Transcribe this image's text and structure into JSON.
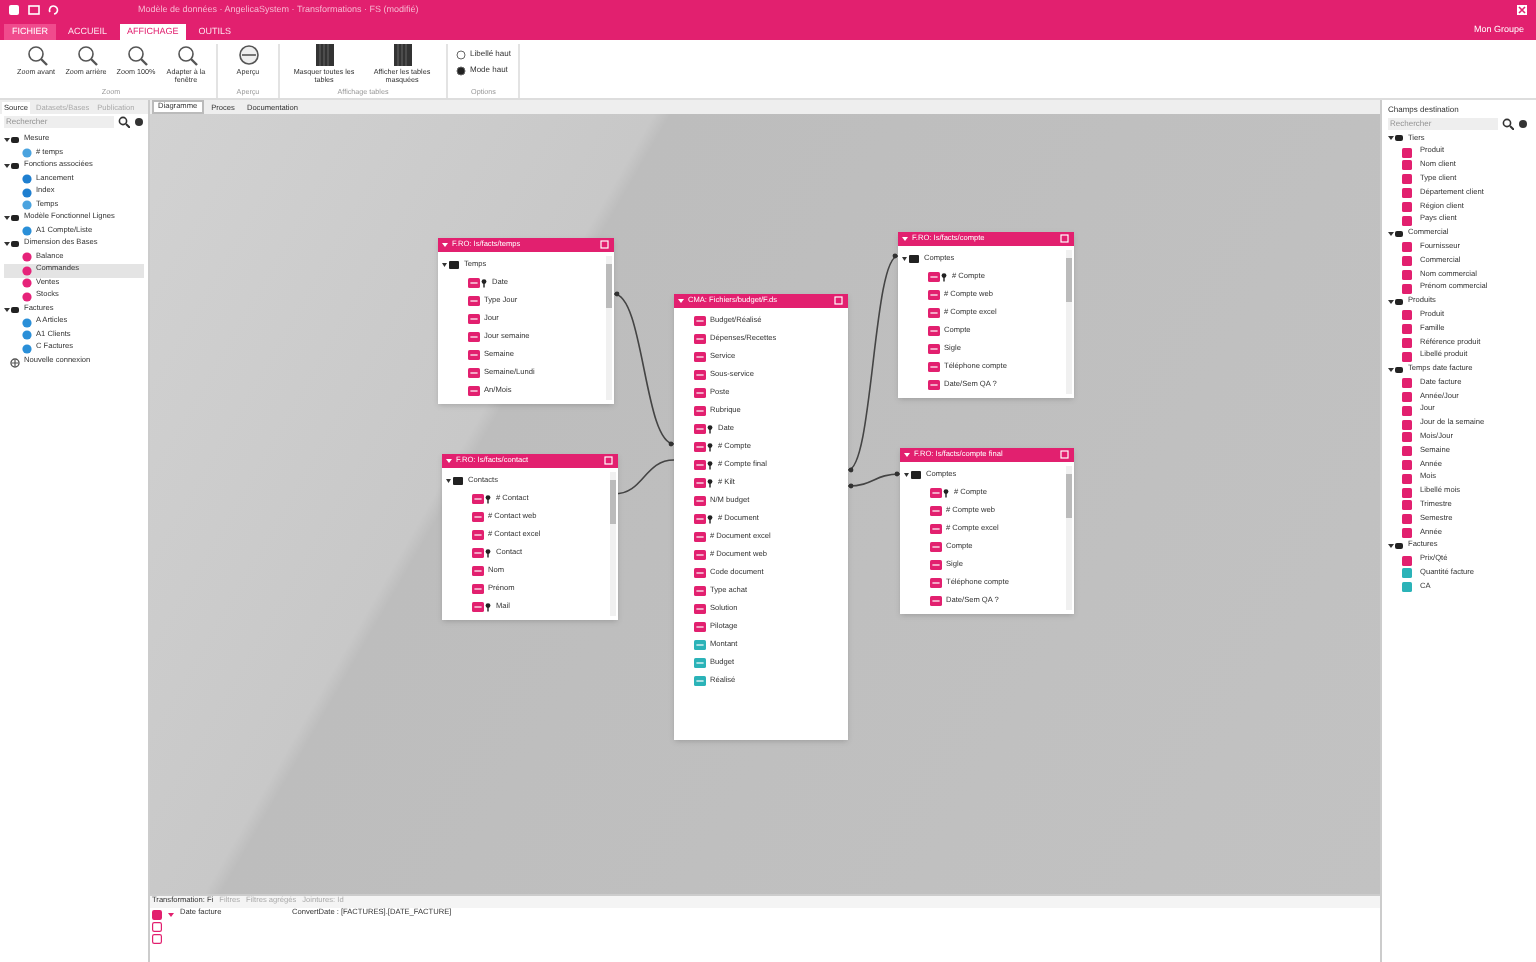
{
  "window": {
    "title": "Modèle de données · AngelicaSystem · Transformations · FS (modifié)",
    "account": "Mon Groupe"
  },
  "ribbon_tabs": [
    {
      "label": "FICHIER",
      "selected": false
    },
    {
      "label": "ACCUEIL",
      "selected": false
    },
    {
      "label": "AFFICHAGE",
      "selected": true
    },
    {
      "label": "OUTILS",
      "selected": false
    }
  ],
  "ribbon_groups": [
    {
      "label": "Zoom",
      "items": [
        {
          "kind": "zoom",
          "label": "Zoom avant"
        },
        {
          "kind": "zoom",
          "label": "Zoom arrière"
        },
        {
          "kind": "zoom",
          "label": "Zoom 100%"
        },
        {
          "kind": "zoom",
          "label": "Adapter à la fenêtre"
        }
      ]
    },
    {
      "label": "Aperçu",
      "items": [
        {
          "kind": "preview",
          "label": "Aperçu"
        }
      ]
    },
    {
      "label": "Affichage tables",
      "items": [
        {
          "kind": "tables",
          "label": "Masquer toutes les tables"
        },
        {
          "kind": "tables",
          "label": "Afficher les tables masquées"
        }
      ]
    },
    {
      "label": "Options",
      "items": [
        {
          "kind": "radio",
          "label": "Libellé haut",
          "selected": false
        },
        {
          "kind": "radio",
          "label": "Mode haut",
          "selected": true
        }
      ]
    }
  ],
  "left_panel": {
    "tabs": [
      {
        "label": "Source",
        "selected": true
      },
      {
        "label": "Datasets/Bases",
        "selected": false
      },
      {
        "label": "Publication",
        "selected": false
      }
    ],
    "search": {
      "placeholder": "Rechercher"
    },
    "tree": [
      {
        "label": "Mesure",
        "children": [
          {
            "label": "# temps",
            "color": "#4aa3df",
            "selected": false
          }
        ]
      },
      {
        "label": "Fonctions associées",
        "children": [
          {
            "label": "Lancement",
            "color": "#1f7fd0",
            "selected": false
          },
          {
            "label": "Index",
            "color": "#1f7fd0",
            "selected": false
          },
          {
            "label": "Temps",
            "color": "#4aa3df",
            "selected": false
          }
        ]
      },
      {
        "label": "Modèle Fonctionnel Lignes",
        "children": [
          {
            "label": "A1 Compte/Liste",
            "color": "#2a8fd8",
            "selected": false
          }
        ]
      },
      {
        "label": "Dimension des Bases",
        "children": [
          {
            "label": "Balance",
            "color": "#e6237a",
            "selected": false
          },
          {
            "label": "Commandes",
            "color": "#e6237a",
            "selected": true
          },
          {
            "label": "Ventes",
            "color": "#e6237a",
            "selected": false
          },
          {
            "label": "Stocks",
            "color": "#e6237a",
            "selected": false
          }
        ]
      },
      {
        "label": "Factures",
        "children": [
          {
            "label": "A Articles",
            "color": "#2a8fd8",
            "selected": false
          },
          {
            "label": "A1 Clients",
            "color": "#2a8fd8",
            "selected": false
          },
          {
            "label": "C Factures",
            "color": "#2a8fd8",
            "selected": false
          }
        ]
      }
    ],
    "footer_item": "Nouvelle connexion"
  },
  "canvas_tabs": [
    {
      "label": "Diagramme",
      "selected": true
    },
    {
      "label": "Proces",
      "selected": false
    },
    {
      "label": "Documentation",
      "selected": false
    }
  ],
  "tables": [
    {
      "title": "F.RO: Is/facts/temps",
      "scroll": true,
      "fields": [
        {
          "label": "Temps",
          "kind": "folder"
        },
        {
          "label": "Date",
          "kind": "dim",
          "key": true
        },
        {
          "label": "Type Jour",
          "kind": "dim"
        },
        {
          "label": "Jour",
          "kind": "dim"
        },
        {
          "label": "Jour semaine",
          "kind": "dim"
        },
        {
          "label": "Semaine",
          "kind": "dim"
        },
        {
          "label": "Semaine/Lundi",
          "kind": "dim"
        },
        {
          "label": "An/Mois",
          "kind": "dim"
        }
      ]
    },
    {
      "title": "F.RO: Is/facts/compte",
      "scroll": true,
      "fields": [
        {
          "label": "Comptes",
          "kind": "folder"
        },
        {
          "label": "# Compte",
          "kind": "dim",
          "key": true
        },
        {
          "label": "# Compte web",
          "kind": "dim"
        },
        {
          "label": "# Compte excel",
          "kind": "dim"
        },
        {
          "label": "Compte",
          "kind": "dim"
        },
        {
          "label": "Sigle",
          "kind": "dim"
        },
        {
          "label": "Téléphone compte",
          "kind": "dim"
        },
        {
          "label": "Date/Sem QA ?",
          "kind": "dim"
        }
      ]
    },
    {
      "title": "F.RO: Is/facts/contact",
      "scroll": true,
      "fields": [
        {
          "label": "Contacts",
          "kind": "folder"
        },
        {
          "label": "# Contact",
          "kind": "dim",
          "key": true
        },
        {
          "label": "# Contact web",
          "kind": "dim"
        },
        {
          "label": "# Contact excel",
          "kind": "dim"
        },
        {
          "label": "Contact",
          "kind": "dim",
          "key": true
        },
        {
          "label": "Nom",
          "kind": "dim"
        },
        {
          "label": "Prénom",
          "kind": "dim"
        },
        {
          "label": "Mail",
          "kind": "dim",
          "key": true
        }
      ]
    },
    {
      "title": "CMA: Fichiers/budget/F.ds",
      "scroll": false,
      "fields": [
        {
          "label": "Budget/Réalisé",
          "kind": "dim"
        },
        {
          "label": "Dépenses/Recettes",
          "kind": "dim"
        },
        {
          "label": "Service",
          "kind": "dim"
        },
        {
          "label": "Sous-service",
          "kind": "dim"
        },
        {
          "label": "Poste",
          "kind": "dim"
        },
        {
          "label": "Rubrique",
          "kind": "dim"
        },
        {
          "label": "Date",
          "kind": "dim",
          "key": true
        },
        {
          "label": "# Compte",
          "kind": "dim",
          "key": true
        },
        {
          "label": "# Compte final",
          "kind": "dim",
          "key": true
        },
        {
          "label": "# Kilt",
          "kind": "dim",
          "key": true
        },
        {
          "label": "N/M budget",
          "kind": "dim"
        },
        {
          "label": "# Document",
          "kind": "dim",
          "key": true
        },
        {
          "label": "# Document excel",
          "kind": "dim"
        },
        {
          "label": "# Document web",
          "kind": "dim"
        },
        {
          "label": "Code document",
          "kind": "dim"
        },
        {
          "label": "Type achat",
          "kind": "dim"
        },
        {
          "label": "Solution",
          "kind": "dim"
        },
        {
          "label": "Pilotage",
          "kind": "dim"
        },
        {
          "label": "Montant",
          "kind": "measure"
        },
        {
          "label": "Budget",
          "kind": "measure"
        },
        {
          "label": "Réalisé",
          "kind": "measure"
        }
      ]
    },
    {
      "title": "F.RO: Is/facts/compte final",
      "scroll": true,
      "fields": [
        {
          "label": "Comptes",
          "kind": "folder"
        },
        {
          "label": "# Compte",
          "kind": "dim",
          "key": true
        },
        {
          "label": "# Compte web",
          "kind": "dim"
        },
        {
          "label": "# Compte excel",
          "kind": "dim"
        },
        {
          "label": "Compte",
          "kind": "dim"
        },
        {
          "label": "Sigle",
          "kind": "dim"
        },
        {
          "label": "Téléphone compte",
          "kind": "dim"
        },
        {
          "label": "Date/Sem QA ?",
          "kind": "dim"
        }
      ]
    }
  ],
  "right_panel": {
    "title": "Champs destination",
    "search": {
      "placeholder": "Rechercher"
    },
    "groups": [
      {
        "label": "Tiers",
        "items": [
          {
            "label": "Produit",
            "kind": "dim"
          },
          {
            "label": "Nom client",
            "kind": "dim"
          },
          {
            "label": "Type client",
            "kind": "dim"
          },
          {
            "label": "Département client",
            "kind": "dim"
          },
          {
            "label": "Région client",
            "kind": "dim"
          },
          {
            "label": "Pays client",
            "kind": "dim"
          }
        ]
      },
      {
        "label": "Commercial",
        "items": [
          {
            "label": "Fournisseur",
            "kind": "dim"
          },
          {
            "label": "Commercial",
            "kind": "dim"
          },
          {
            "label": "Nom commercial",
            "kind": "dim"
          },
          {
            "label": "Prénom commercial",
            "kind": "dim"
          }
        ]
      },
      {
        "label": "Produits",
        "items": [
          {
            "label": "Produit",
            "kind": "dim"
          },
          {
            "label": "Famille",
            "kind": "dim"
          },
          {
            "label": "Référence produit",
            "kind": "dim"
          },
          {
            "label": "Libellé produit",
            "kind": "dim"
          }
        ]
      },
      {
        "label": "Temps date facture",
        "items": [
          {
            "label": "Date facture",
            "kind": "dim"
          },
          {
            "label": "Année/Jour",
            "kind": "dim"
          },
          {
            "label": "Jour",
            "kind": "dim"
          },
          {
            "label": "Jour de la semaine",
            "kind": "dim"
          },
          {
            "label": "Mois/Jour",
            "kind": "dim"
          },
          {
            "label": "Semaine",
            "kind": "dim"
          },
          {
            "label": "Année",
            "kind": "dim"
          },
          {
            "label": "Mois",
            "kind": "dim"
          },
          {
            "label": "Libellé mois",
            "kind": "dim"
          },
          {
            "label": "Trimestre",
            "kind": "dim"
          },
          {
            "label": "Semestre",
            "kind": "dim"
          },
          {
            "label": "Année",
            "kind": "dim"
          }
        ]
      },
      {
        "label": "Factures",
        "items": [
          {
            "label": "Prix/Qté",
            "kind": "dim"
          },
          {
            "label": "Quantité facture",
            "kind": "measure"
          },
          {
            "label": "CA",
            "kind": "measure"
          }
        ]
      }
    ]
  },
  "bottom_panel": {
    "tabs": [
      {
        "label": "Transformation: Fi",
        "selected": true
      },
      {
        "label": "Filtres",
        "selected": false
      },
      {
        "label": "Filtres agrégés",
        "selected": false
      },
      {
        "label": "Jointures: Id",
        "selected": false
      }
    ],
    "rows": [
      {
        "name": "Date facture",
        "expression": "ConvertDate : [FACTURES].[DATE_FACTURE]"
      },
      {},
      {}
    ]
  }
}
